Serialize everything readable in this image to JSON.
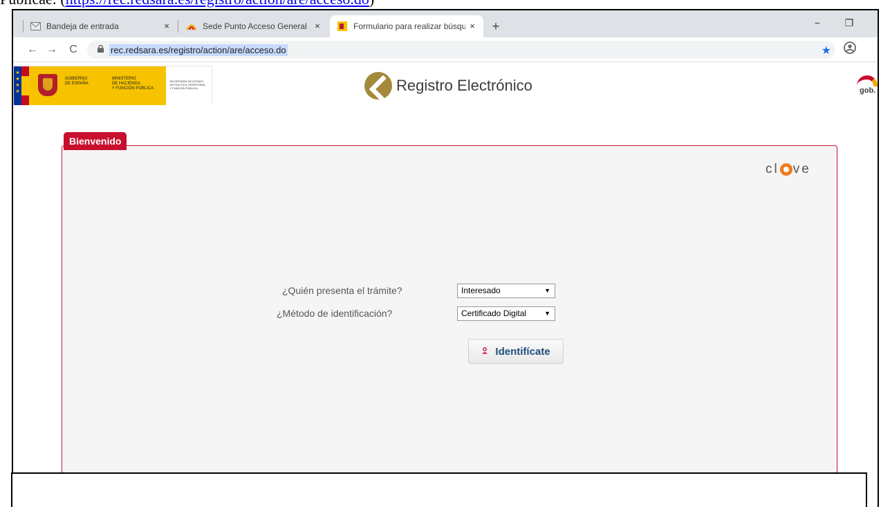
{
  "doc_top": {
    "prefix": "Publicae: (",
    "link": "https://rec.redsara.es/registro/action/are/acceso.do",
    "suffix": ")"
  },
  "browser": {
    "tabs": [
      {
        "label": "Bandeja de entrada",
        "icon": "mail-icon",
        "active": false
      },
      {
        "label": "Sede Punto Acceso General - Reg",
        "icon": "pag-icon",
        "active": false
      },
      {
        "label": "Formulario para realizar búsqued",
        "icon": "gov-icon",
        "active": true
      }
    ],
    "tab_close": "×",
    "new_tab": "+",
    "minimize": "−",
    "restore": "❐",
    "back": "←",
    "forward": "→",
    "reload": "C",
    "url": "rec.redsara.es/registro/action/are/acceso.do",
    "bookmark_icon": "star-icon",
    "profile_icon": "account-icon"
  },
  "header": {
    "gov_left_1": "Gobierno\nde España",
    "gov_left_2": "Ministerio\nde Hacienda\ny Función Pública",
    "gov_right": "Secretaría de Estado\nde Política Territorial\ny Función Pública",
    "title": "Registro Electrónico",
    "gob_text": "gob."
  },
  "panel": {
    "title": "Bienvenido",
    "clave_left": "cl",
    "clave_right": "ve",
    "question_1": "¿Quién presenta el trámite?",
    "select_1": "Interesado",
    "question_2": "¿Método de identificación?",
    "select_2": "Certificado Digital",
    "caret": "▼",
    "button": "Identifícate"
  },
  "colors": {
    "accent": "#c8102e",
    "button_text": "#1f4e79",
    "panel_bg": "#f5f5f5",
    "url_highlight": "#c6dafc"
  }
}
